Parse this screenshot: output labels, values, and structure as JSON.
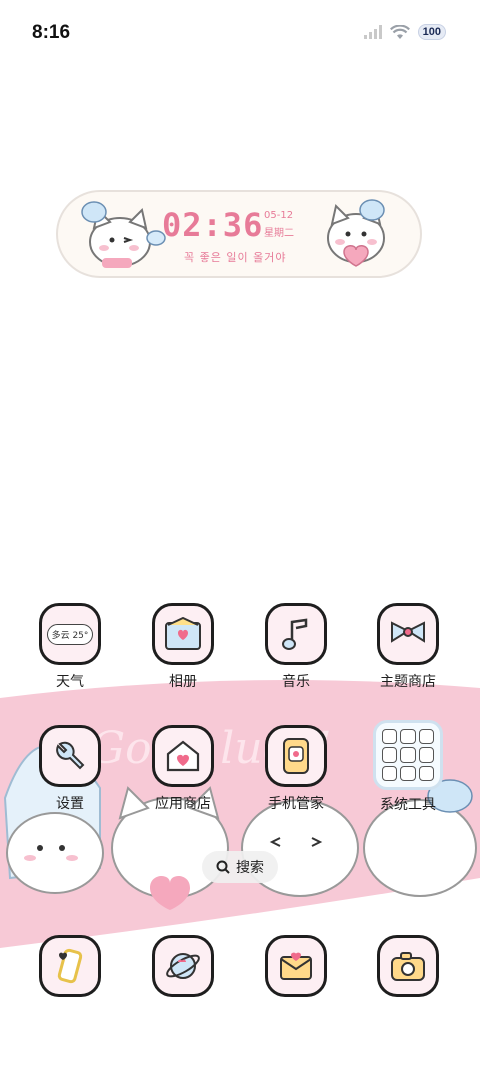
{
  "status_bar": {
    "time": "8:16",
    "battery": "100"
  },
  "clock_widget": {
    "time": "02:36",
    "date": "05-12",
    "weekday": "星期二",
    "quote": "꼭 좋은 일이 올거야"
  },
  "weather_widget": {
    "label": "多云 25°"
  },
  "apps_row1": [
    {
      "label": "天气"
    },
    {
      "label": "相册"
    },
    {
      "label": "音乐"
    },
    {
      "label": "主题商店"
    }
  ],
  "apps_row2": [
    {
      "label": "设置"
    },
    {
      "label": "应用商店"
    },
    {
      "label": "手机管家"
    },
    {
      "label": "系统工具"
    }
  ],
  "search": {
    "label": "搜索"
  },
  "dock_icons": [
    "phone-icon",
    "browser-icon",
    "messages-icon",
    "camera-icon"
  ],
  "colors": {
    "accent_pink": "#e77b98",
    "banner_pink": "#f7c9d6",
    "icon_bg": "#fdeff3"
  }
}
